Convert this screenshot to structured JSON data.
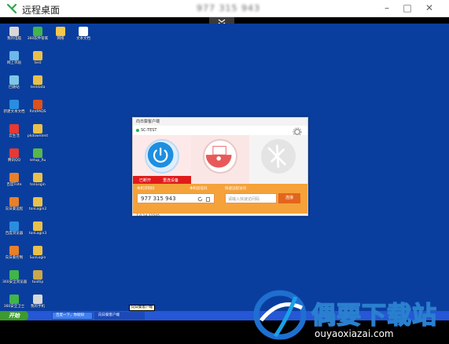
{
  "app": {
    "title": "远程桌面",
    "remote_id": "977 315 943",
    "window_buttons": [
      "–",
      "□",
      "✕"
    ],
    "accent": "#2aa84a"
  },
  "desktop": {
    "background": "#0a3e9e",
    "icons": [
      {
        "label": "我的电脑",
        "icon": "computer-icon",
        "color": "#d8d8d8"
      },
      {
        "label": "360软件管家",
        "icon": "app-icon",
        "color": "#3fb54a"
      },
      {
        "label": "网络",
        "icon": "app-icon",
        "color": "#f5c84c"
      },
      {
        "label": "文本文档",
        "icon": "document-icon",
        "color": "#ffffff"
      },
      {
        "label": "网上邻居",
        "icon": "network-icon",
        "color": "#6fb7e9"
      },
      {
        "label": "test",
        "icon": "folder-icon",
        "color": "#e8c04a"
      },
      {
        "label": "回收站",
        "icon": "recycle-bin-icon",
        "color": "#7cc7e8"
      },
      {
        "label": "testdata",
        "icon": "folder-icon",
        "color": "#e8c04a"
      },
      {
        "label": "新建文本文档",
        "icon": "app-icon",
        "color": "#2a8ee0"
      },
      {
        "label": "RmtPADS",
        "icon": "app-icon",
        "color": "#d9531e"
      },
      {
        "label": "云生活",
        "icon": "app-icon",
        "color": "#e53935"
      },
      {
        "label": "pkdowntest",
        "icon": "folder-icon",
        "color": "#e8c04a"
      },
      {
        "label": "腾讯QQ",
        "icon": "app-icon",
        "color": "#e53935"
      },
      {
        "label": "setup_Ru",
        "icon": "app-icon",
        "color": "#57b74a"
      },
      {
        "label": "百度Tsite",
        "icon": "app-icon",
        "color": "#e8802a"
      },
      {
        "label": "tonLogin",
        "icon": "folder-icon",
        "color": "#e8c04a"
      },
      {
        "label": "向日葵远程",
        "icon": "app-icon",
        "color": "#e8802a"
      },
      {
        "label": "tonLogin2",
        "icon": "folder-icon",
        "color": "#e8c04a"
      },
      {
        "label": "百度浏览器",
        "icon": "app-icon",
        "color": "#2a8ee0"
      },
      {
        "label": "tonLogin3",
        "icon": "folder-icon",
        "color": "#e8c04a"
      },
      {
        "label": "向日葵控制",
        "icon": "app-icon",
        "color": "#e8802a"
      },
      {
        "label": "SunLogin",
        "icon": "folder-icon",
        "color": "#e8c04a"
      },
      {
        "label": "360安全浏览器",
        "icon": "app-icon",
        "color": "#3fb54a"
      },
      {
        "label": "tooltip",
        "icon": "app-icon",
        "color": "#c9a84a"
      },
      {
        "label": "360安全卫士",
        "icon": "app-icon",
        "color": "#3fb54a"
      },
      {
        "label": "我的手机",
        "icon": "app-icon",
        "color": "#d8d8d8"
      }
    ]
  },
  "client_window": {
    "title": "向日葵客户端",
    "status": "SC-TEST",
    "tiles": [
      {
        "name": "remote-assist",
        "status_text": "已断开",
        "status_action": "重连设备"
      },
      {
        "name": "desktop-control"
      },
      {
        "name": "unavailable"
      }
    ],
    "id_label": "本机识别码",
    "verify_label": "本机验证码",
    "remote_label": "快速远程访问",
    "device_id": "977 315 943",
    "remote_placeholder": "请输入快速访问码",
    "connect_button": "连接",
    "version": "7.0.14.32505"
  },
  "taskbar": {
    "start_label": "开始",
    "tasks": [
      {
        "label": "百度一下，你就知",
        "active": false
      },
      {
        "label": "向日葵客户端",
        "active": true
      }
    ],
    "tooltip": "向日葵客户端"
  },
  "watermark": {
    "name": "偶要下载站",
    "url": "ouyaoxiazai.com"
  }
}
